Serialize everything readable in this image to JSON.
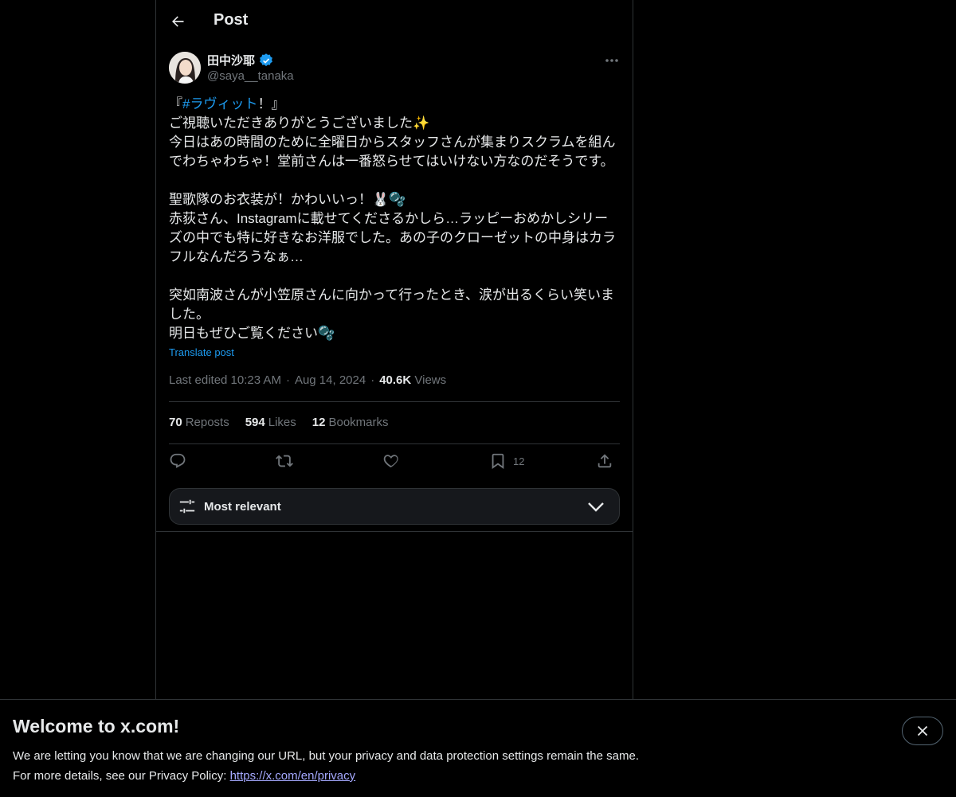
{
  "header": {
    "title": "Post"
  },
  "author": {
    "display_name": "田中沙耶",
    "handle": "@saya__tanaka"
  },
  "post": {
    "lines": [
      "ご視聴いただきありがとうございました✨",
      "今日はあの時間のために全曜日からスタッフさんが集まりスクラムを組ん",
      "でわちゃわちゃ！堂前さんは一番怒らせてはいけない方なのだそうです。",
      "",
      "聖歌隊のお衣装が！かわいいっ！🐰🫧",
      "赤荻さん、Instagramに載せてくださるかしら…ラッピーおめかしシリー",
      "ズの中でも特に好きなお洋服でした。あの子のクローゼットの中身はカラ",
      "フルなんだろうなぁ…",
      "",
      "突如南波さんが小笠原さんに向かって行ったとき、涙が出るくらい笑いま",
      "した。",
      "明日もぜひご覧ください🫧"
    ],
    "first_line_open": "『",
    "hashtag": "#ラヴィット",
    "first_line_close": "！』",
    "translate_label": "Translate post"
  },
  "meta": {
    "edited": "Last edited 10:23 AM",
    "date": "Aug 14, 2024",
    "views_count": "40.6K",
    "views_label": "Views",
    "sep": "·"
  },
  "stats": {
    "reposts_count": "70",
    "reposts_label": "Reposts",
    "likes_count": "594",
    "likes_label": "Likes",
    "bookmarks_count": "12",
    "bookmarks_label": "Bookmarks"
  },
  "actions": {
    "bookmark_count": "12"
  },
  "sort": {
    "label": "Most relevant"
  },
  "banner": {
    "title": "Welcome to x.com!",
    "line1": "We are letting you know that we are changing our URL, but your privacy and data protection settings remain the same.",
    "line2_prefix": "For more details, see our Privacy Policy: ",
    "link_text": "https://x.com/en/privacy"
  },
  "colors": {
    "accent": "#1d9bf0",
    "background": "#000000",
    "muted": "#71767b",
    "border": "#2f3336",
    "link": "#a5a9ff"
  },
  "icons": [
    "back-arrow-icon",
    "verified-badge-icon",
    "more-icon",
    "reply-icon",
    "repost-icon",
    "like-icon",
    "bookmark-icon",
    "share-icon",
    "filter-icon",
    "chevron-down-icon",
    "close-icon"
  ]
}
